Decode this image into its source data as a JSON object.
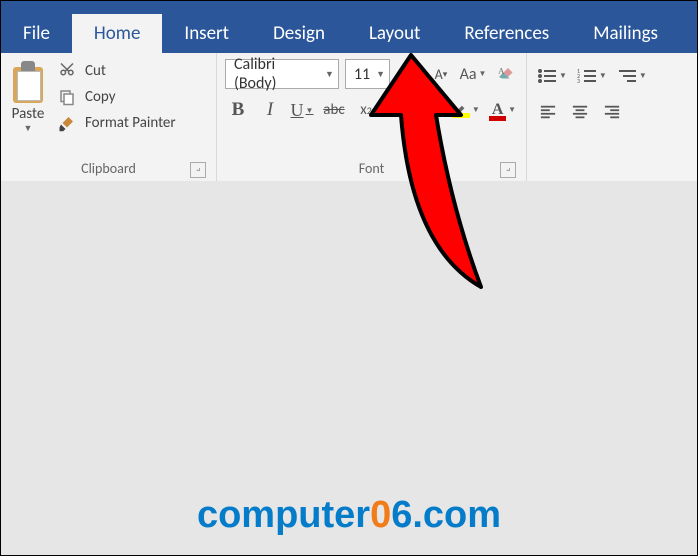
{
  "tabs": {
    "file": "File",
    "home": "Home",
    "insert": "Insert",
    "design": "Design",
    "layout": "Layout",
    "references": "References",
    "mailings": "Mailings"
  },
  "clipboard": {
    "paste": "Paste",
    "cut": "Cut",
    "copy": "Copy",
    "format_painter": "Format Painter",
    "group_label": "Clipboard"
  },
  "font": {
    "name": "Calibri (Body)",
    "size": "11",
    "group_label": "Font"
  },
  "watermark": {
    "part1": "computer",
    "zero": "0",
    "part2": "6.com"
  }
}
